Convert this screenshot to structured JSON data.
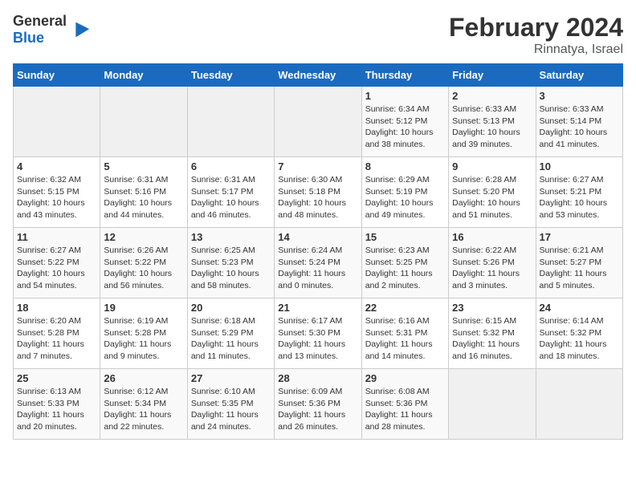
{
  "header": {
    "logo_general": "General",
    "logo_blue": "Blue",
    "month_title": "February 2024",
    "location": "Rinnatya, Israel"
  },
  "days_of_week": [
    "Sunday",
    "Monday",
    "Tuesday",
    "Wednesday",
    "Thursday",
    "Friday",
    "Saturday"
  ],
  "weeks": [
    [
      {
        "day": "",
        "info": ""
      },
      {
        "day": "",
        "info": ""
      },
      {
        "day": "",
        "info": ""
      },
      {
        "day": "",
        "info": ""
      },
      {
        "day": "1",
        "info": "Sunrise: 6:34 AM\nSunset: 5:12 PM\nDaylight: 10 hours\nand 38 minutes."
      },
      {
        "day": "2",
        "info": "Sunrise: 6:33 AM\nSunset: 5:13 PM\nDaylight: 10 hours\nand 39 minutes."
      },
      {
        "day": "3",
        "info": "Sunrise: 6:33 AM\nSunset: 5:14 PM\nDaylight: 10 hours\nand 41 minutes."
      }
    ],
    [
      {
        "day": "4",
        "info": "Sunrise: 6:32 AM\nSunset: 5:15 PM\nDaylight: 10 hours\nand 43 minutes."
      },
      {
        "day": "5",
        "info": "Sunrise: 6:31 AM\nSunset: 5:16 PM\nDaylight: 10 hours\nand 44 minutes."
      },
      {
        "day": "6",
        "info": "Sunrise: 6:31 AM\nSunset: 5:17 PM\nDaylight: 10 hours\nand 46 minutes."
      },
      {
        "day": "7",
        "info": "Sunrise: 6:30 AM\nSunset: 5:18 PM\nDaylight: 10 hours\nand 48 minutes."
      },
      {
        "day": "8",
        "info": "Sunrise: 6:29 AM\nSunset: 5:19 PM\nDaylight: 10 hours\nand 49 minutes."
      },
      {
        "day": "9",
        "info": "Sunrise: 6:28 AM\nSunset: 5:20 PM\nDaylight: 10 hours\nand 51 minutes."
      },
      {
        "day": "10",
        "info": "Sunrise: 6:27 AM\nSunset: 5:21 PM\nDaylight: 10 hours\nand 53 minutes."
      }
    ],
    [
      {
        "day": "11",
        "info": "Sunrise: 6:27 AM\nSunset: 5:22 PM\nDaylight: 10 hours\nand 54 minutes."
      },
      {
        "day": "12",
        "info": "Sunrise: 6:26 AM\nSunset: 5:22 PM\nDaylight: 10 hours\nand 56 minutes."
      },
      {
        "day": "13",
        "info": "Sunrise: 6:25 AM\nSunset: 5:23 PM\nDaylight: 10 hours\nand 58 minutes."
      },
      {
        "day": "14",
        "info": "Sunrise: 6:24 AM\nSunset: 5:24 PM\nDaylight: 11 hours\nand 0 minutes."
      },
      {
        "day": "15",
        "info": "Sunrise: 6:23 AM\nSunset: 5:25 PM\nDaylight: 11 hours\nand 2 minutes."
      },
      {
        "day": "16",
        "info": "Sunrise: 6:22 AM\nSunset: 5:26 PM\nDaylight: 11 hours\nand 3 minutes."
      },
      {
        "day": "17",
        "info": "Sunrise: 6:21 AM\nSunset: 5:27 PM\nDaylight: 11 hours\nand 5 minutes."
      }
    ],
    [
      {
        "day": "18",
        "info": "Sunrise: 6:20 AM\nSunset: 5:28 PM\nDaylight: 11 hours\nand 7 minutes."
      },
      {
        "day": "19",
        "info": "Sunrise: 6:19 AM\nSunset: 5:28 PM\nDaylight: 11 hours\nand 9 minutes."
      },
      {
        "day": "20",
        "info": "Sunrise: 6:18 AM\nSunset: 5:29 PM\nDaylight: 11 hours\nand 11 minutes."
      },
      {
        "day": "21",
        "info": "Sunrise: 6:17 AM\nSunset: 5:30 PM\nDaylight: 11 hours\nand 13 minutes."
      },
      {
        "day": "22",
        "info": "Sunrise: 6:16 AM\nSunset: 5:31 PM\nDaylight: 11 hours\nand 14 minutes."
      },
      {
        "day": "23",
        "info": "Sunrise: 6:15 AM\nSunset: 5:32 PM\nDaylight: 11 hours\nand 16 minutes."
      },
      {
        "day": "24",
        "info": "Sunrise: 6:14 AM\nSunset: 5:32 PM\nDaylight: 11 hours\nand 18 minutes."
      }
    ],
    [
      {
        "day": "25",
        "info": "Sunrise: 6:13 AM\nSunset: 5:33 PM\nDaylight: 11 hours\nand 20 minutes."
      },
      {
        "day": "26",
        "info": "Sunrise: 6:12 AM\nSunset: 5:34 PM\nDaylight: 11 hours\nand 22 minutes."
      },
      {
        "day": "27",
        "info": "Sunrise: 6:10 AM\nSunset: 5:35 PM\nDaylight: 11 hours\nand 24 minutes."
      },
      {
        "day": "28",
        "info": "Sunrise: 6:09 AM\nSunset: 5:36 PM\nDaylight: 11 hours\nand 26 minutes."
      },
      {
        "day": "29",
        "info": "Sunrise: 6:08 AM\nSunset: 5:36 PM\nDaylight: 11 hours\nand 28 minutes."
      },
      {
        "day": "",
        "info": ""
      },
      {
        "day": "",
        "info": ""
      }
    ]
  ]
}
